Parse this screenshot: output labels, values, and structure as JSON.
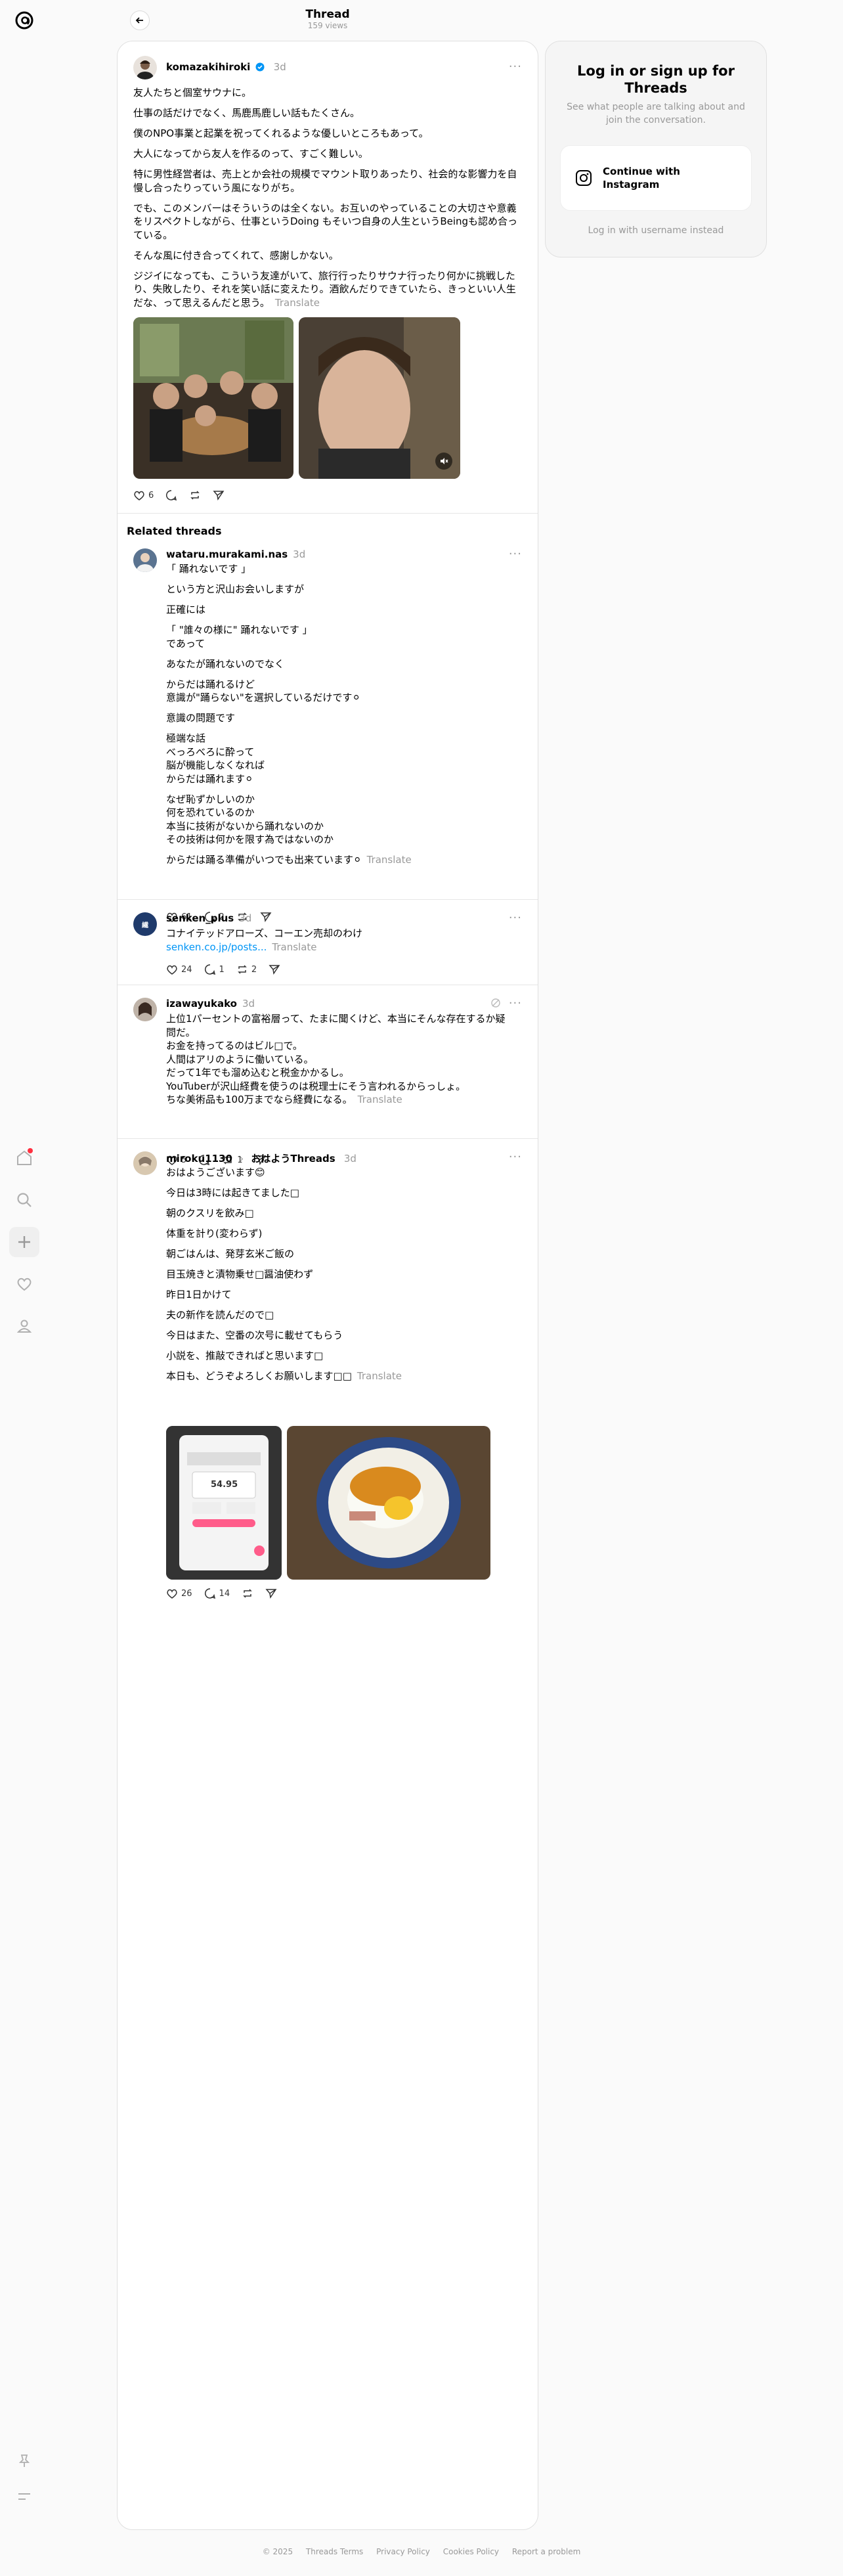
{
  "header": {
    "title": "Thread",
    "views": "159 views"
  },
  "main_post": {
    "username": "komazakihiroki",
    "time": "3d",
    "paragraphs": [
      "友人たちと個室サウナに。",
      "仕事の話だけでなく、馬鹿馬鹿しい話もたくさん。",
      "僕のNPO事業と起業を祝ってくれるような優しいところもあって。",
      "大人になってから友人を作るのって、すごく難しい。",
      "特に男性経営者は、売上とか会社の規模でマウント取りあったり、社会的な影響力を自慢し合ったりっていう風になりがち。",
      "でも、このメンバーはそういうのは全くない。お互いのやっていることの大切さや意義をリスペクトしながら、仕事というDoing もそいつ自身の人生というBeingも認め合っている。",
      "そんな風に付き合ってくれて、感謝しかない。",
      "ジジイになっても、こういう友達がいて、旅行行ったりサウナ行ったり何かに挑戦したり、失敗したり、それを笑い話に変えたり。酒飲んだりできていたら、きっといい人生だな、って思えるんだと思う。"
    ],
    "translate": "Translate",
    "likes": "6"
  },
  "related_title": "Related threads",
  "posts": [
    {
      "username": "wataru.murakami.nas",
      "time": "3d",
      "paragraphs": [
        "「 踊れないです 」",
        "という方と沢山お会いしますが",
        "正確には",
        "「 \"誰々の様に\" 踊れないです 」\nであって",
        "あなたが踊れないのでなく",
        "からだは踊れるけど\n意識が\"踊らない\"を選択しているだけです⚪︎",
        "意識の問題です",
        "極端な話\nべっろべろに酔って\n脳が機能しなくなれば\nからだは踊れます⚪︎",
        "なぜ恥ずかしいのか\n何を恐れているのか\n本当に技術がないから踊れないのか\nその技術は何かを限す為ではないのか",
        "からだは踊る準備がいつでも出来ています⚪︎"
      ],
      "translate": "Translate",
      "likes": "61",
      "replies": "2",
      "reposts": ""
    },
    {
      "username": "senken_plus",
      "time": "3d",
      "paragraphs": [
        "コナイテッドアローズ、コーエン売却のわけ"
      ],
      "link": "senken.co.jp/posts...",
      "translate": "Translate",
      "likes": "24",
      "replies": "1",
      "reposts": "2"
    },
    {
      "username": "izawayukako",
      "time": "3d",
      "paragraphs": [
        "上位1パーセントの富裕層って、たまに聞くけど、本当にそんな存在するか疑問だ。\nお金を持ってるのはビル□で。\n人間はアリのように働いている。\nだって1年でも溜め込むと税金かかるし。\nYouTuberが沢山経費を使うのは税理士にそう言われるからっしょ。\nちな美術品も100万までなら経費になる。"
      ],
      "translate": "Translate",
      "likes": "5",
      "replies": "",
      "reposts": "1"
    },
    {
      "username": "miroku1130",
      "community": "おはようThreads",
      "time": "3d",
      "paragraphs": [
        "おはようございます😊",
        "今日は3時には起きてました□",
        "朝のクスリを飲み□",
        "体重を計り(変わらず)",
        "朝ごはんは、発芽玄米ご飯の",
        "目玉焼きと漬物乗せ□醤油使わず",
        "昨日1日かけて",
        "夫の新作を読んだので□",
        "今日はまた、空番の次号に載せてもらう",
        "小説を、推敲できればと思います□",
        "本日も、どうぞよろしくお願いします□□"
      ],
      "translate": "Translate",
      "scale_reading": "54.95",
      "likes": "26",
      "replies": "14",
      "reposts": ""
    }
  ],
  "login": {
    "title": "Log in or sign up for Threads",
    "subtitle": "See what people are talking about and join the conversation.",
    "instagram": "Continue with Instagram",
    "alt": "Log in with username instead"
  },
  "footer": {
    "copyright": "© 2025",
    "terms": "Threads Terms",
    "privacy": "Privacy Policy",
    "cookies": "Cookies Policy",
    "report": "Report a problem"
  },
  "colors": {
    "accent_blue": "#0095f6",
    "notification_red": "#ff3040",
    "link": "#00376b"
  }
}
